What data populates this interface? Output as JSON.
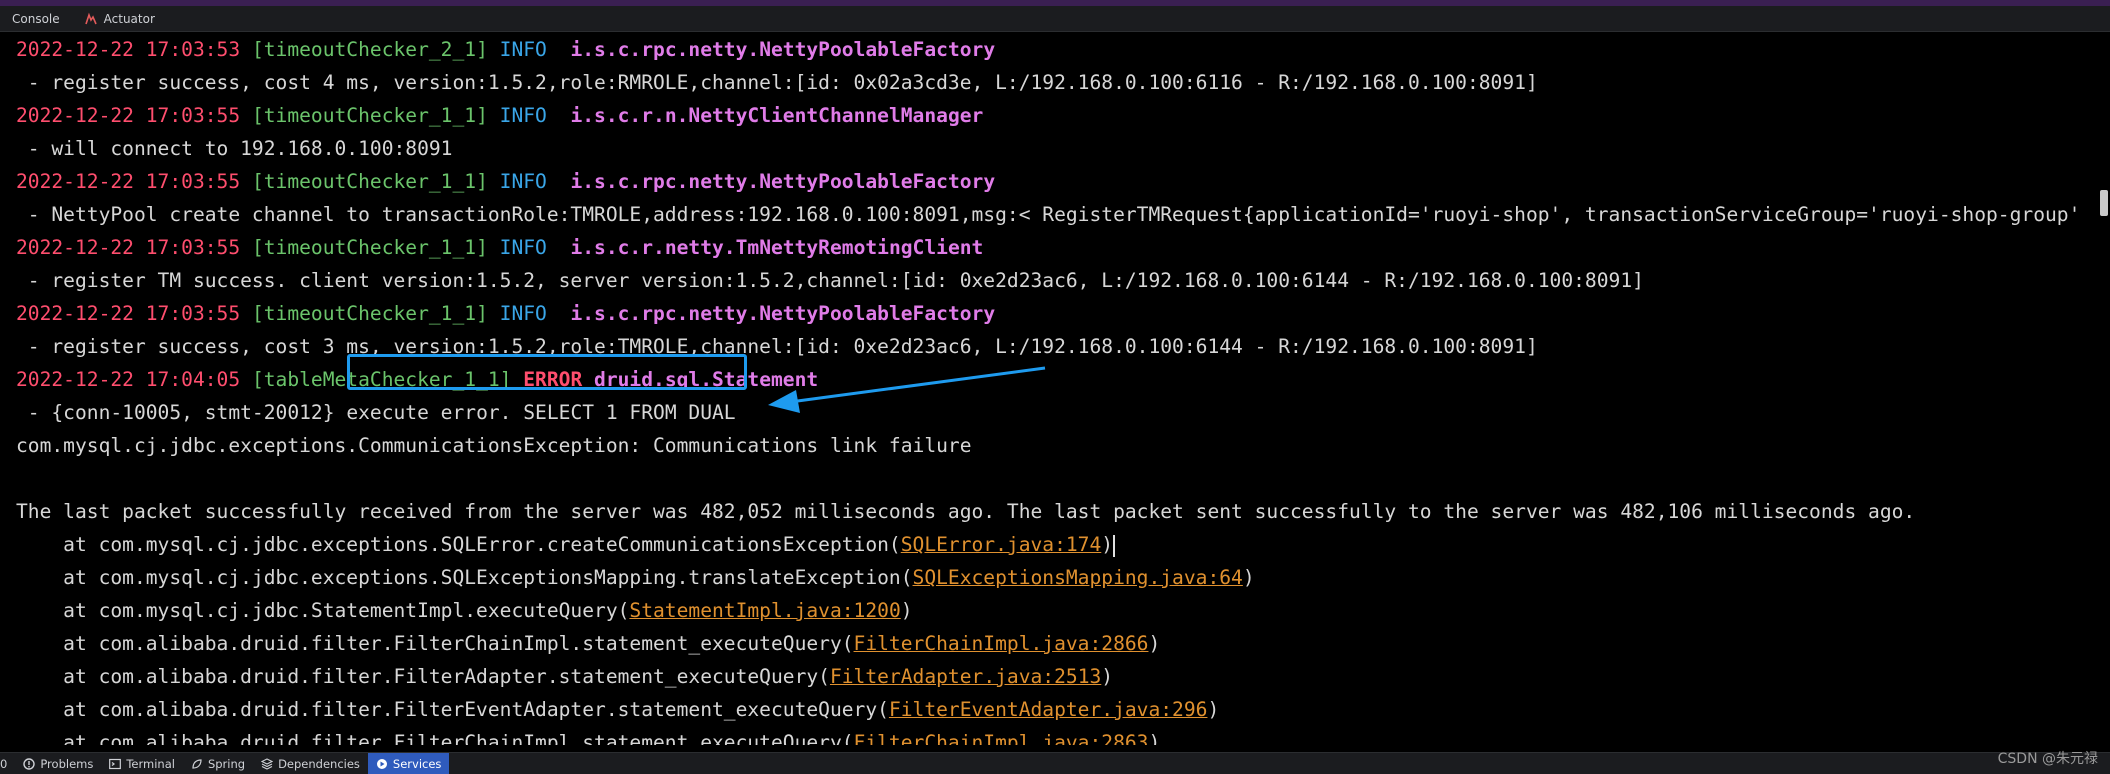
{
  "tabs": [
    {
      "label": "Console",
      "icon": "console-icon"
    },
    {
      "label": "Actuator",
      "icon": "actuator-icon"
    }
  ],
  "log": {
    "l1": {
      "ts": "2022-12-22 17:03:53",
      "thread": "[timeoutChecker_2_1]",
      "level": "INFO",
      "logger": "i.s.c.rpc.netty.NettyPoolableFactory"
    },
    "l2": " - register success, cost 4 ms, version:1.5.2,role:RMROLE,channel:[id: 0x02a3cd3e, L:/192.168.0.100:6116 - R:/192.168.0.100:8091]",
    "l3": {
      "ts": "2022-12-22 17:03:55",
      "thread": "[timeoutChecker_1_1]",
      "level": "INFO",
      "logger": "i.s.c.r.n.NettyClientChannelManager"
    },
    "l4": " - will connect to 192.168.0.100:8091",
    "l5": {
      "ts": "2022-12-22 17:03:55",
      "thread": "[timeoutChecker_1_1]",
      "level": "INFO",
      "logger": "i.s.c.rpc.netty.NettyPoolableFactory"
    },
    "l6": " - NettyPool create channel to transactionRole:TMROLE,address:192.168.0.100:8091,msg:< RegisterTMRequest{applicationId='ruoyi-shop', transactionServiceGroup='ruoyi-shop-group'",
    "l7": {
      "ts": "2022-12-22 17:03:55",
      "thread": "[timeoutChecker_1_1]",
      "level": "INFO",
      "logger": "i.s.c.r.netty.TmNettyRemotingClient"
    },
    "l8": " - register TM success. client version:1.5.2, server version:1.5.2,channel:[id: 0xe2d23ac6, L:/192.168.0.100:6144 - R:/192.168.0.100:8091]",
    "l9": {
      "ts": "2022-12-22 17:03:55",
      "thread": "[timeoutChecker_1_1]",
      "level": "INFO",
      "logger": "i.s.c.rpc.netty.NettyPoolableFactory"
    },
    "l10": " - register success, cost 3 ms, version:1.5.2,role:TMROLE,channel:[id: 0xe2d23ac6, L:/192.168.0.100:6144 - R:/192.168.0.100:8091]",
    "l11": {
      "ts": "2022-12-22 17:04:05",
      "thread": "[tableMetaChecker_1_1]",
      "level": "ERROR",
      "logger": "druid.sql.Statement"
    },
    "l12": {
      "prefix": " - {conn-10005, stmt-20012} ",
      "highlight": "execute error. SELECT 1 FROM DUAL"
    },
    "l13": "com.mysql.cj.jdbc.exceptions.CommunicationsException: Communications link failure",
    "l15": "The last packet successfully received from the server was 482,052 milliseconds ago. The last packet sent successfully to the server was 482,106 milliseconds ago.",
    "stack": [
      {
        "pre": "    at com.mysql.cj.jdbc.exceptions.SQLError.createCommunicationsException(",
        "link": "SQLError.java:174",
        "post": ")"
      },
      {
        "pre": "    at com.mysql.cj.jdbc.exceptions.SQLExceptionsMapping.translateException(",
        "link": "SQLExceptionsMapping.java:64",
        "post": ")"
      },
      {
        "pre": "    at com.mysql.cj.jdbc.StatementImpl.executeQuery(",
        "link": "StatementImpl.java:1200",
        "post": ")"
      },
      {
        "pre": "    at com.alibaba.druid.filter.FilterChainImpl.statement_executeQuery(",
        "link": "FilterChainImpl.java:2866",
        "post": ")"
      },
      {
        "pre": "    at com.alibaba.druid.filter.FilterAdapter.statement_executeQuery(",
        "link": "FilterAdapter.java:2513",
        "post": ")"
      },
      {
        "pre": "    at com.alibaba.druid.filter.FilterEventAdapter.statement_executeQuery(",
        "link": "FilterEventAdapter.java:296",
        "post": ")"
      },
      {
        "pre": "    at com.alibaba.druid.filter.FilterChainImpl.statement_executeQuery(",
        "link": "FilterChainImpl.java:2863",
        "post": ")"
      }
    ]
  },
  "statusbar": {
    "zero": "0",
    "items": [
      {
        "label": "Problems",
        "icon": "problems-icon"
      },
      {
        "label": "Terminal",
        "icon": "terminal-icon"
      },
      {
        "label": "Spring",
        "icon": "spring-icon"
      },
      {
        "label": "Dependencies",
        "icon": "dependencies-icon"
      },
      {
        "label": "Services",
        "icon": "services-icon"
      }
    ]
  },
  "watermark": "CSDN @朱元禄",
  "colors": {
    "accent": "#1e9bef",
    "timestamp": "#ff4e6e",
    "thread": "#6bc46b",
    "info": "#3aa6e8",
    "logger": "#e07ce8",
    "link": "#e0912f",
    "services_active": "#2f5bbd"
  }
}
